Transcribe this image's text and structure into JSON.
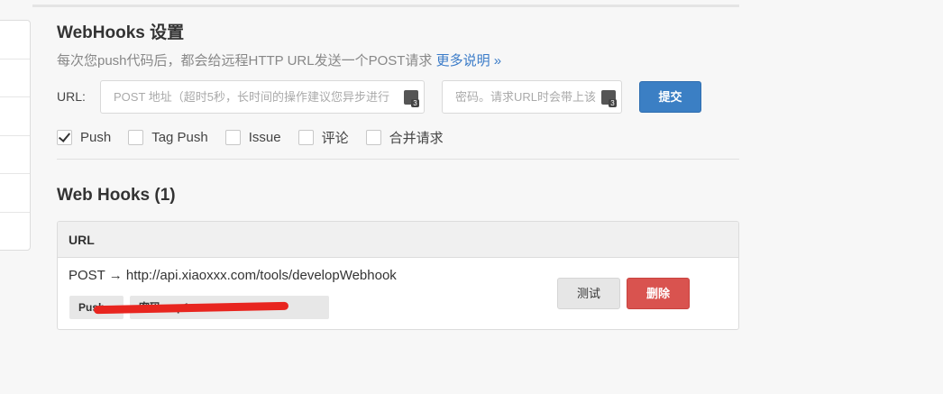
{
  "settings": {
    "title": "WebHooks 设置",
    "description": "每次您push代码后，都会给远程HTTP URL发送一个POST请求",
    "more_link": "更多说明 »",
    "url_label": "URL:",
    "url_placeholder": "POST 地址（超时5秒，长时间的操作建议您异步进行",
    "password_placeholder": "密码。请求URL时会带上该",
    "submit_label": "提交",
    "events": [
      {
        "label": "Push",
        "checked": true
      },
      {
        "label": "Tag Push",
        "checked": false
      },
      {
        "label": "Issue",
        "checked": false
      },
      {
        "label": "评论",
        "checked": false
      },
      {
        "label": "合并请求",
        "checked": false
      }
    ]
  },
  "hooks": {
    "title": "Web Hooks (1)",
    "column_header": "URL",
    "items": [
      {
        "url": "POST → http://api.xiaoxxx.com/tools/developWebhook",
        "event_tag": "Push",
        "password_tag": "密码: mp1",
        "test_label": "测试",
        "delete_label": "删除"
      }
    ]
  },
  "colors": {
    "accent": "#3b7fc4",
    "danger": "#d9534f",
    "link": "#3a7bc8",
    "redaction": "#e8251f"
  },
  "icons": [
    "keyboard-icon",
    "checkmark-icon"
  ]
}
